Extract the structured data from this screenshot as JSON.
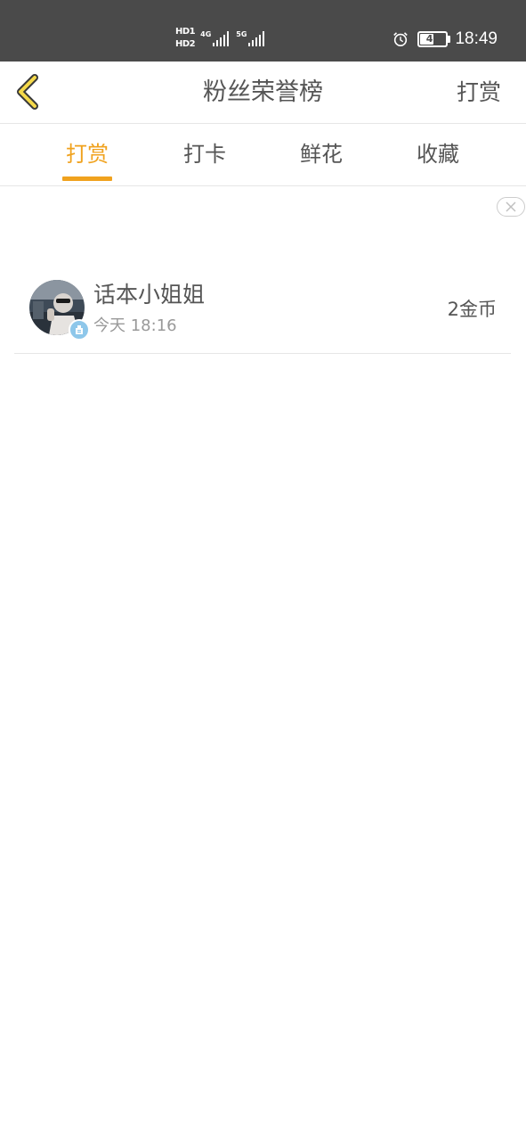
{
  "status_bar": {
    "hd1": "HD1",
    "hd2": "HD2",
    "net1": "4G",
    "net2": "5G",
    "battery": "48",
    "time": "18:49"
  },
  "nav": {
    "title": "粉丝荣誉榜",
    "action": "打赏",
    "back_icon": "chevron-left-icon"
  },
  "tabs": [
    {
      "label": "打赏",
      "active": true
    },
    {
      "label": "打卡",
      "active": false
    },
    {
      "label": "鲜花",
      "active": false
    },
    {
      "label": "收藏",
      "active": false
    }
  ],
  "fans": [
    {
      "name": "话本小姐姐",
      "time": "今天 18:16",
      "amount": "2金币"
    }
  ],
  "colors": {
    "accent": "#f0a21e",
    "status_bar": "#4a4a4a",
    "text": "#555555",
    "subtext": "#999999",
    "divider": "#e6e6e6"
  }
}
